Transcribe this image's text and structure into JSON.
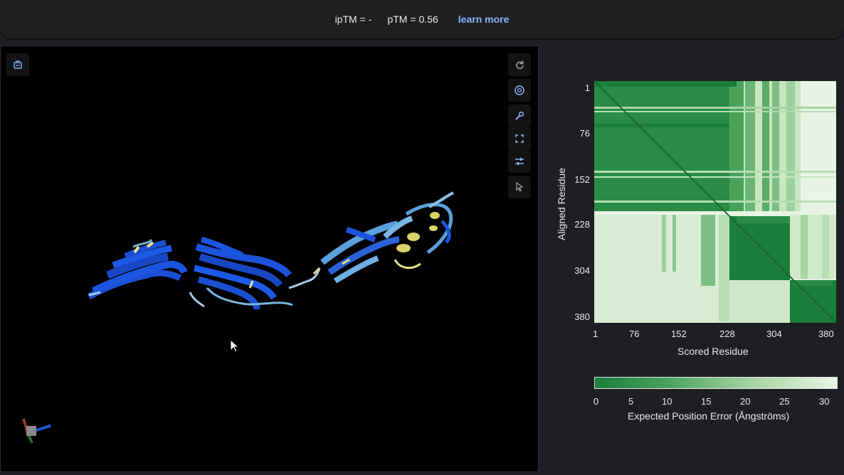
{
  "metrics": {
    "iptm_label": "ipTM =",
    "iptm_value": "-",
    "ptm_label": "pTM =",
    "ptm_value": "0.56",
    "learn_more": "learn more"
  },
  "viewer": {
    "icons": [
      "viewer-mode-icon",
      "rotate-icon",
      "aperture-icon",
      "wrench-icon",
      "fullscreen-icon",
      "sliders-icon",
      "cursor-select-icon"
    ]
  },
  "pae": {
    "y_axis_title": "Aligned Residue",
    "x_axis_title": "Scored Residue",
    "ticks": [
      "1",
      "76",
      "152",
      "228",
      "304",
      "380"
    ],
    "colorbar_ticks": [
      "0",
      "5",
      "10",
      "15",
      "20",
      "25",
      "30"
    ],
    "colorbar_title": "Expected Position Error (Ångströms)",
    "colors": {
      "low": "#1b7e3b",
      "high": "#e8f5e4"
    }
  }
}
